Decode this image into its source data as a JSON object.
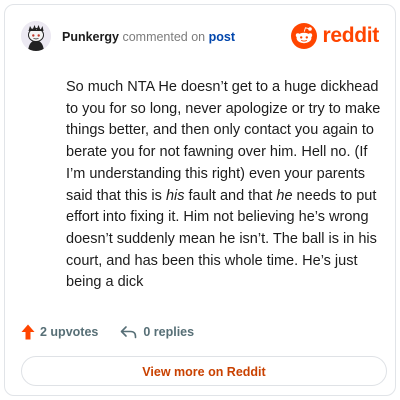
{
  "header": {
    "username": "Punkergy",
    "action_text": "commented on",
    "post_link": "post",
    "brand_name": "reddit"
  },
  "comment": {
    "segments": [
      "So much NTA He doesn’t get to a huge dickhead to you for so long, never apologize or try to make things better, and then only contact you again to berate you for not fawning over him. Hell no. (If I’m understanding this right) even your parents said that this is ",
      "his",
      " fault and that ",
      "he",
      " needs to put effort into fixing it. Him not believing he’s wrong doesn’t suddenly mean he isn’t. The ball is in his court, and has been this whole time. He’s just being a dick"
    ]
  },
  "actions": {
    "upvotes_label": "2 upvotes",
    "replies_label": "0 replies"
  },
  "view_button_label": "View more on Reddit",
  "colors": {
    "brand": "#ff4500",
    "upvote_arrow": "#ff4500",
    "link": "#0045ac",
    "button_text": "#c94100"
  },
  "icons": {
    "avatar": "snoo-avatar",
    "brand": "reddit-logo-icon",
    "upvote": "upvote-arrow-icon",
    "reply": "reply-arrow-icon"
  }
}
